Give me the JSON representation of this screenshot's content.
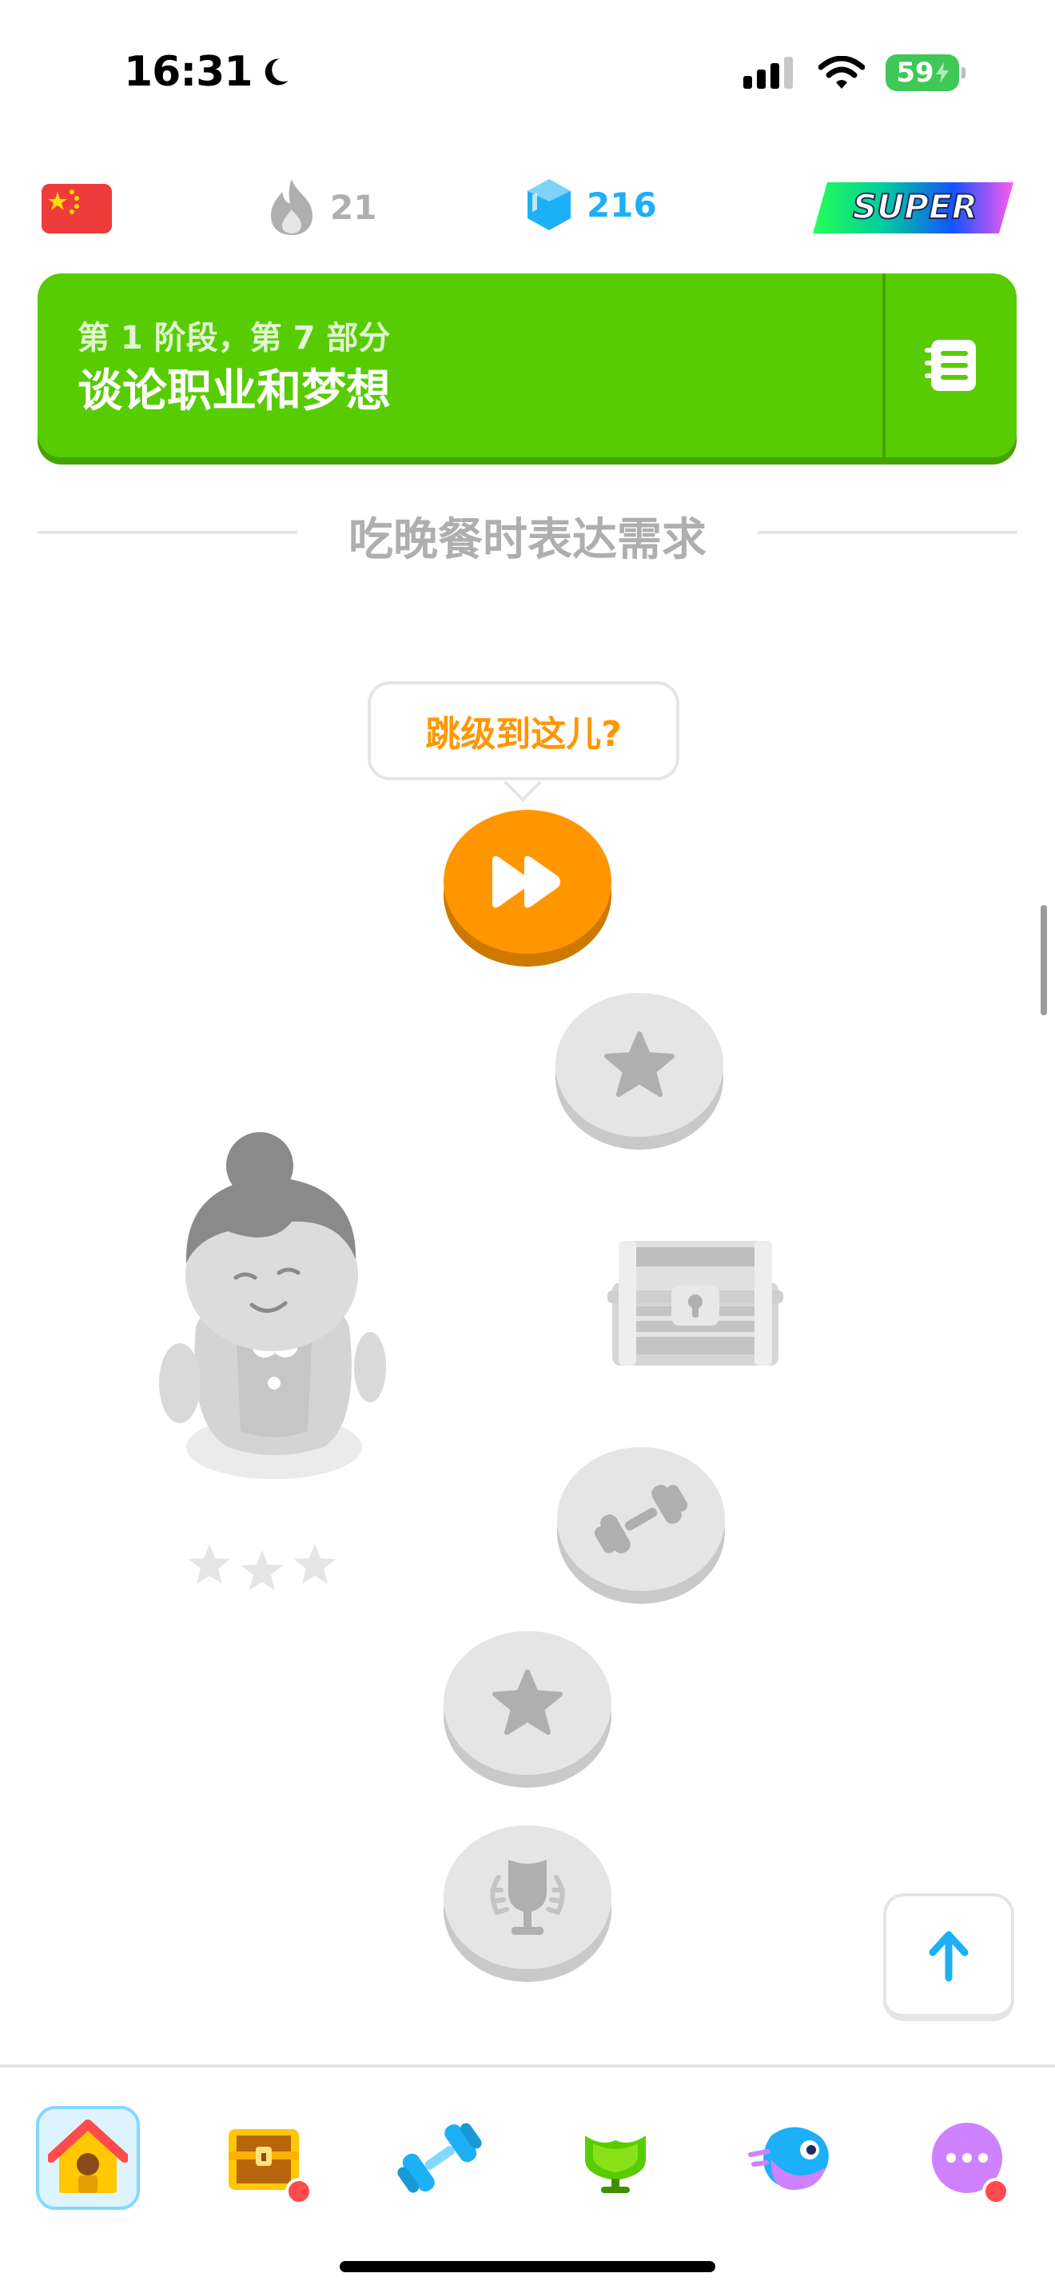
{
  "status_bar": {
    "time": "16:31",
    "battery": "59"
  },
  "top_stats": {
    "course_flag": "china-flag",
    "streak_count": "21",
    "gems_count": "216",
    "super_label": "SUPER"
  },
  "unit_banner": {
    "subtitle": "第 1 阶段，第 7 部分",
    "title": "谈论职业和梦想",
    "color": "#58cc02"
  },
  "section": {
    "label": "吃晚餐时表达需求"
  },
  "path": {
    "tooltip": "跳级到这儿?",
    "nodes": [
      {
        "type": "jump-here",
        "icon": "fast-forward-icon",
        "state": "active"
      },
      {
        "type": "lesson",
        "icon": "star-icon",
        "state": "locked"
      },
      {
        "type": "treasure-chest",
        "icon": "chest-icon",
        "state": "locked"
      },
      {
        "type": "practice",
        "icon": "dumbbell-icon",
        "state": "locked"
      },
      {
        "type": "lesson",
        "icon": "star-icon",
        "state": "locked"
      },
      {
        "type": "unit-review",
        "icon": "trophy-icon",
        "state": "locked"
      }
    ],
    "character": "grandma-character",
    "character_stars": 3
  },
  "bottom_nav": {
    "items": [
      {
        "name": "home",
        "icon": "house-icon",
        "active": true
      },
      {
        "name": "chest",
        "icon": "chest-icon",
        "badge": true
      },
      {
        "name": "practice",
        "icon": "dumbbell-icon"
      },
      {
        "name": "leaderboard",
        "icon": "trophy-icon"
      },
      {
        "name": "characters",
        "icon": "bird-icon"
      },
      {
        "name": "more",
        "icon": "more-icon",
        "badge": true
      }
    ]
  },
  "colors": {
    "accent_green": "#58cc02",
    "accent_orange": "#ff9600",
    "gem_blue": "#1cb0f6",
    "locked_gray": "#e5e5e5"
  }
}
